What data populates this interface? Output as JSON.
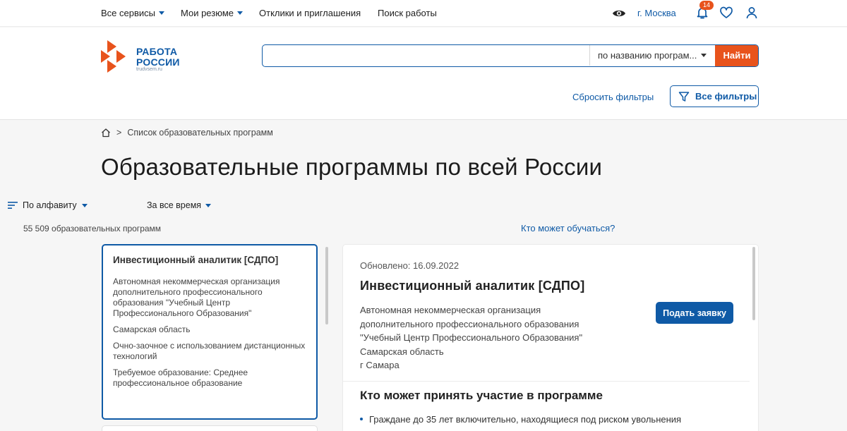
{
  "topnav": {
    "services": "Все сервисы",
    "resumes": "Мои резюме",
    "responses": "Отклики и приглашения",
    "jobsearch": "Поиск работы",
    "city": "г. Москва",
    "notifications_count": "14"
  },
  "logo": {
    "line1": "РАБОТА",
    "line2": "РОССИИ",
    "domain": "trudvsem.ru"
  },
  "search": {
    "value": "",
    "placeholder": "",
    "mode": "по названию програм...",
    "button": "Найти"
  },
  "filters": {
    "reset": "Сбросить фильтры",
    "all": "Все фильтры"
  },
  "breadcrumb": {
    "current": "Список образовательных программ",
    "separator": ">"
  },
  "page": {
    "title": "Образовательные программы по всей России"
  },
  "controls": {
    "sort": "По алфавиту",
    "period": "За все время",
    "count": "55 509 образовательных программ",
    "who_link": "Кто может обучаться?"
  },
  "list": {
    "items": [
      {
        "title": "Инвестиционный аналитик [СДПО]",
        "org": "Автономная некоммерческая организация дополнительного профессионального образования \"Учебный Центр Профессионального Образования\"",
        "region": "Самарская область",
        "format": "Очно-заочное с использованием дистанционных технологий",
        "education": "Требуемое образование: Среднее профессиональное образование"
      }
    ]
  },
  "detail": {
    "updated": "Обновлено: 16.09.2022",
    "title": "Инвестиционный аналитик [СДПО]",
    "org_line1": "Автономная некоммерческая организация",
    "org_line2": "дополнительного профессионального образования",
    "org_line3": "\"Учебный Центр Профессионального Образования\"",
    "region": "Самарская область",
    "city": "г Самара",
    "apply": "Подать заявку",
    "who_title": "Кто может принять участие в программе",
    "bullet1": "Граждане до 35 лет включительно, находящиеся под риском увольнения"
  },
  "colors": {
    "primary": "#0f5aa6",
    "accent": "#e8531c"
  }
}
